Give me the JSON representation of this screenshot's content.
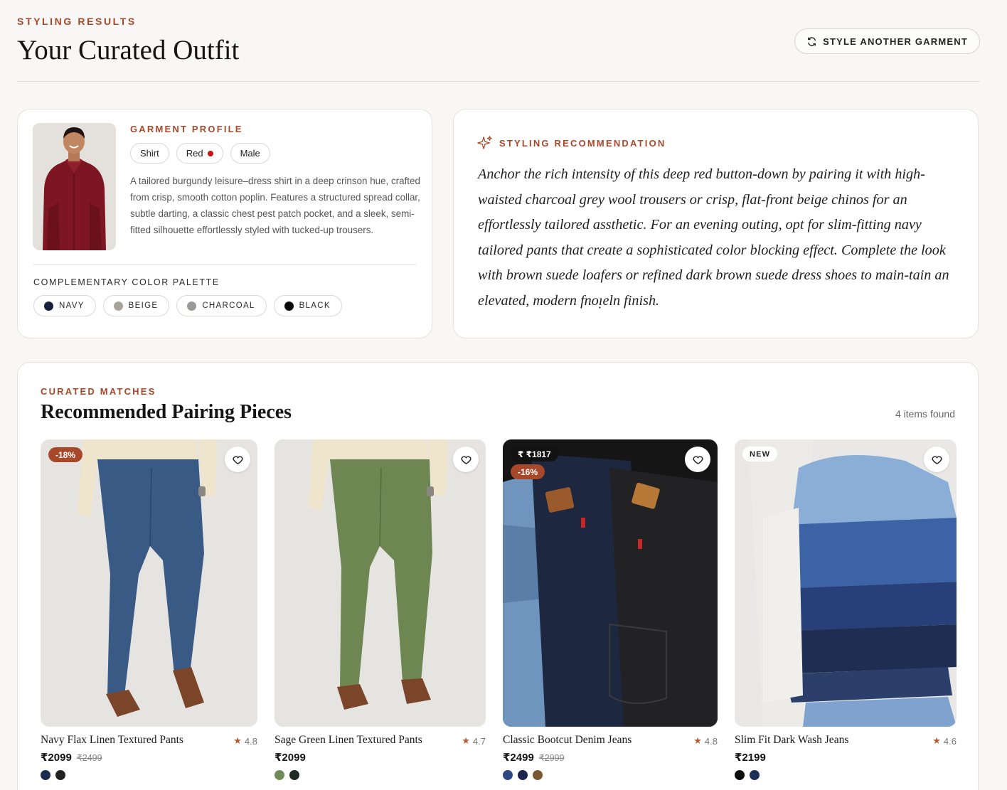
{
  "header": {
    "eyebrow": "STYLING RESULTS",
    "title": "Your Curated Outfit",
    "restyle_label": "STYLE ANOTHER GARMENT"
  },
  "profile": {
    "eyebrow": "GARMENT PROFILE",
    "tags": [
      "Shirt",
      "Red",
      "Male"
    ],
    "description": "A tailored burgundy leisure–dress shirt in a deep crinson hue, crafted from crisp, smooth cotton poplin. Features a structured spread collar, subtle darting, a classic chest pest patch pocket, and a sleek, semi-fitted silhouette effortlessly styled with tucked-up trousers.",
    "palette_label": "COMPLEMENTARY COLOR PALETTE",
    "palette": [
      {
        "label": "NAVY",
        "color": "#15213f"
      },
      {
        "label": "BEIGE",
        "color": "#a9a49b"
      },
      {
        "label": "CHARCOAL",
        "color": "#9a9a99"
      },
      {
        "label": "BLACK",
        "color": "#0c0c0c"
      }
    ]
  },
  "recommendation": {
    "eyebrow": "STYLING RECOMMENDATION",
    "text": "Anchor the rich intensity of this deep red button-down by pairing it with high-waisted charcoal grey wool trousers or crisp, flat-front beige chinos for an effortlessly tailored assthetic. For an evening outing, opt for slim-fitting navy tailored pants that create a sophisticated color blocking effect. Complete the look with brown suede loafers or refined dark brown suede dress shoes to main-tain an elevated, modern fnoᴉeln finish."
  },
  "matches": {
    "eyebrow": "CURATED MATCHES",
    "title": "Recommended Pairing Pieces",
    "count": "4 items found",
    "products": [
      {
        "name": "Navy Flax Linen Textured Pants",
        "rating": "4.8",
        "price": "₹2099",
        "old_price": "₹2499",
        "badges": [
          "-18%"
        ],
        "colors": [
          "#1b2b52",
          "#222222"
        ]
      },
      {
        "name": "Sage Green Linen Textured Pants",
        "rating": "4.7",
        "price": "₹2099",
        "old_price": "",
        "badges": [],
        "colors": [
          "#6f8b58",
          "#1f2b22"
        ]
      },
      {
        "name": "Classic Bootcut Denim Jeans",
        "rating": "4.8",
        "price": "₹2499",
        "old_price": "₹2999",
        "badges": [
          "₹ ₹1817",
          "-16%"
        ],
        "colors": [
          "#2d4a86",
          "#1b2550",
          "#7a5833"
        ]
      },
      {
        "name": "Slim Fit Dark Wash Jeans",
        "rating": "4.6",
        "price": "₹2199",
        "old_price": "",
        "badges": [
          "NEW"
        ],
        "colors": [
          "#0d0d0d",
          "#1c2f57"
        ]
      }
    ]
  },
  "colors": {
    "accent": "#a8482a",
    "star": "#b15a34"
  }
}
